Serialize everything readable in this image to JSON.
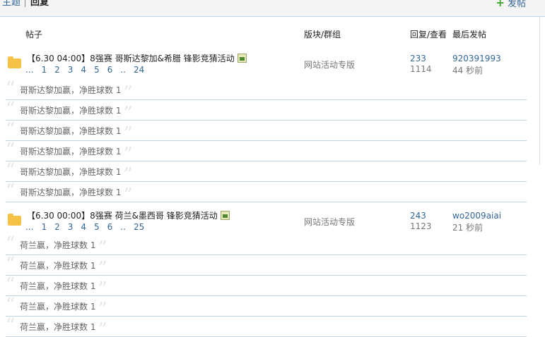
{
  "tabs": {
    "topics": "主题",
    "replies": "回复"
  },
  "new_post": "发帖",
  "columns": {
    "topic": "帖子",
    "forum": "版块/群组",
    "stats": "回复/查看",
    "last": "最后发帖"
  },
  "threads": [
    {
      "title": "【6.30 04:00】8强赛 哥斯达黎加&希腊 锋影竞猜活动",
      "pages": [
        "...",
        "1",
        "2",
        "3",
        "4",
        "5",
        "6",
        "..",
        "24"
      ],
      "forum": "网站活动专版",
      "replies": "233",
      "views": "1114",
      "last_user": "920391993",
      "last_time": "44 秒前",
      "reply_items": [
        "哥斯达黎加赢，净胜球数 1",
        "哥斯达黎加赢，净胜球数 1",
        "哥斯达黎加赢，净胜球数 1",
        "哥斯达黎加赢，净胜球数 1",
        "哥斯达黎加赢，净胜球数 1",
        "哥斯达黎加赢，净胜球数 1"
      ]
    },
    {
      "title": "【6.30 00:00】8强赛 荷兰&墨西哥 锋影竞猜活动",
      "pages": [
        "...",
        "1",
        "2",
        "3",
        "4",
        "5",
        "6",
        "..",
        "25"
      ],
      "forum": "网站活动专版",
      "replies": "243",
      "views": "1123",
      "last_user": "wo2009aiai",
      "last_time": "21 秒前",
      "reply_items": [
        "荷兰赢，净胜球数 1",
        "荷兰赢，净胜球数 1",
        "荷兰赢，净胜球数 1",
        "荷兰赢，净胜球数 1",
        "荷兰赢，净胜球数 1"
      ]
    }
  ]
}
